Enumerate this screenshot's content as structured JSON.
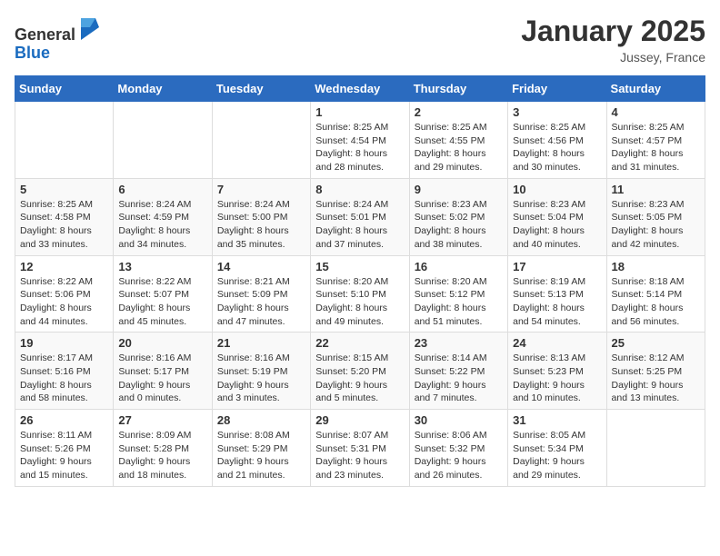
{
  "logo": {
    "general": "General",
    "blue": "Blue"
  },
  "title": "January 2025",
  "location": "Jussey, France",
  "days_header": [
    "Sunday",
    "Monday",
    "Tuesday",
    "Wednesday",
    "Thursday",
    "Friday",
    "Saturday"
  ],
  "weeks": [
    [
      {
        "day": "",
        "sunrise": "",
        "sunset": "",
        "daylight": ""
      },
      {
        "day": "",
        "sunrise": "",
        "sunset": "",
        "daylight": ""
      },
      {
        "day": "",
        "sunrise": "",
        "sunset": "",
        "daylight": ""
      },
      {
        "day": "1",
        "sunrise": "Sunrise: 8:25 AM",
        "sunset": "Sunset: 4:54 PM",
        "daylight": "Daylight: 8 hours and 28 minutes."
      },
      {
        "day": "2",
        "sunrise": "Sunrise: 8:25 AM",
        "sunset": "Sunset: 4:55 PM",
        "daylight": "Daylight: 8 hours and 29 minutes."
      },
      {
        "day": "3",
        "sunrise": "Sunrise: 8:25 AM",
        "sunset": "Sunset: 4:56 PM",
        "daylight": "Daylight: 8 hours and 30 minutes."
      },
      {
        "day": "4",
        "sunrise": "Sunrise: 8:25 AM",
        "sunset": "Sunset: 4:57 PM",
        "daylight": "Daylight: 8 hours and 31 minutes."
      }
    ],
    [
      {
        "day": "5",
        "sunrise": "Sunrise: 8:25 AM",
        "sunset": "Sunset: 4:58 PM",
        "daylight": "Daylight: 8 hours and 33 minutes."
      },
      {
        "day": "6",
        "sunrise": "Sunrise: 8:24 AM",
        "sunset": "Sunset: 4:59 PM",
        "daylight": "Daylight: 8 hours and 34 minutes."
      },
      {
        "day": "7",
        "sunrise": "Sunrise: 8:24 AM",
        "sunset": "Sunset: 5:00 PM",
        "daylight": "Daylight: 8 hours and 35 minutes."
      },
      {
        "day": "8",
        "sunrise": "Sunrise: 8:24 AM",
        "sunset": "Sunset: 5:01 PM",
        "daylight": "Daylight: 8 hours and 37 minutes."
      },
      {
        "day": "9",
        "sunrise": "Sunrise: 8:23 AM",
        "sunset": "Sunset: 5:02 PM",
        "daylight": "Daylight: 8 hours and 38 minutes."
      },
      {
        "day": "10",
        "sunrise": "Sunrise: 8:23 AM",
        "sunset": "Sunset: 5:04 PM",
        "daylight": "Daylight: 8 hours and 40 minutes."
      },
      {
        "day": "11",
        "sunrise": "Sunrise: 8:23 AM",
        "sunset": "Sunset: 5:05 PM",
        "daylight": "Daylight: 8 hours and 42 minutes."
      }
    ],
    [
      {
        "day": "12",
        "sunrise": "Sunrise: 8:22 AM",
        "sunset": "Sunset: 5:06 PM",
        "daylight": "Daylight: 8 hours and 44 minutes."
      },
      {
        "day": "13",
        "sunrise": "Sunrise: 8:22 AM",
        "sunset": "Sunset: 5:07 PM",
        "daylight": "Daylight: 8 hours and 45 minutes."
      },
      {
        "day": "14",
        "sunrise": "Sunrise: 8:21 AM",
        "sunset": "Sunset: 5:09 PM",
        "daylight": "Daylight: 8 hours and 47 minutes."
      },
      {
        "day": "15",
        "sunrise": "Sunrise: 8:20 AM",
        "sunset": "Sunset: 5:10 PM",
        "daylight": "Daylight: 8 hours and 49 minutes."
      },
      {
        "day": "16",
        "sunrise": "Sunrise: 8:20 AM",
        "sunset": "Sunset: 5:12 PM",
        "daylight": "Daylight: 8 hours and 51 minutes."
      },
      {
        "day": "17",
        "sunrise": "Sunrise: 8:19 AM",
        "sunset": "Sunset: 5:13 PM",
        "daylight": "Daylight: 8 hours and 54 minutes."
      },
      {
        "day": "18",
        "sunrise": "Sunrise: 8:18 AM",
        "sunset": "Sunset: 5:14 PM",
        "daylight": "Daylight: 8 hours and 56 minutes."
      }
    ],
    [
      {
        "day": "19",
        "sunrise": "Sunrise: 8:17 AM",
        "sunset": "Sunset: 5:16 PM",
        "daylight": "Daylight: 8 hours and 58 minutes."
      },
      {
        "day": "20",
        "sunrise": "Sunrise: 8:16 AM",
        "sunset": "Sunset: 5:17 PM",
        "daylight": "Daylight: 9 hours and 0 minutes."
      },
      {
        "day": "21",
        "sunrise": "Sunrise: 8:16 AM",
        "sunset": "Sunset: 5:19 PM",
        "daylight": "Daylight: 9 hours and 3 minutes."
      },
      {
        "day": "22",
        "sunrise": "Sunrise: 8:15 AM",
        "sunset": "Sunset: 5:20 PM",
        "daylight": "Daylight: 9 hours and 5 minutes."
      },
      {
        "day": "23",
        "sunrise": "Sunrise: 8:14 AM",
        "sunset": "Sunset: 5:22 PM",
        "daylight": "Daylight: 9 hours and 7 minutes."
      },
      {
        "day": "24",
        "sunrise": "Sunrise: 8:13 AM",
        "sunset": "Sunset: 5:23 PM",
        "daylight": "Daylight: 9 hours and 10 minutes."
      },
      {
        "day": "25",
        "sunrise": "Sunrise: 8:12 AM",
        "sunset": "Sunset: 5:25 PM",
        "daylight": "Daylight: 9 hours and 13 minutes."
      }
    ],
    [
      {
        "day": "26",
        "sunrise": "Sunrise: 8:11 AM",
        "sunset": "Sunset: 5:26 PM",
        "daylight": "Daylight: 9 hours and 15 minutes."
      },
      {
        "day": "27",
        "sunrise": "Sunrise: 8:09 AM",
        "sunset": "Sunset: 5:28 PM",
        "daylight": "Daylight: 9 hours and 18 minutes."
      },
      {
        "day": "28",
        "sunrise": "Sunrise: 8:08 AM",
        "sunset": "Sunset: 5:29 PM",
        "daylight": "Daylight: 9 hours and 21 minutes."
      },
      {
        "day": "29",
        "sunrise": "Sunrise: 8:07 AM",
        "sunset": "Sunset: 5:31 PM",
        "daylight": "Daylight: 9 hours and 23 minutes."
      },
      {
        "day": "30",
        "sunrise": "Sunrise: 8:06 AM",
        "sunset": "Sunset: 5:32 PM",
        "daylight": "Daylight: 9 hours and 26 minutes."
      },
      {
        "day": "31",
        "sunrise": "Sunrise: 8:05 AM",
        "sunset": "Sunset: 5:34 PM",
        "daylight": "Daylight: 9 hours and 29 minutes."
      },
      {
        "day": "",
        "sunrise": "",
        "sunset": "",
        "daylight": ""
      }
    ]
  ]
}
